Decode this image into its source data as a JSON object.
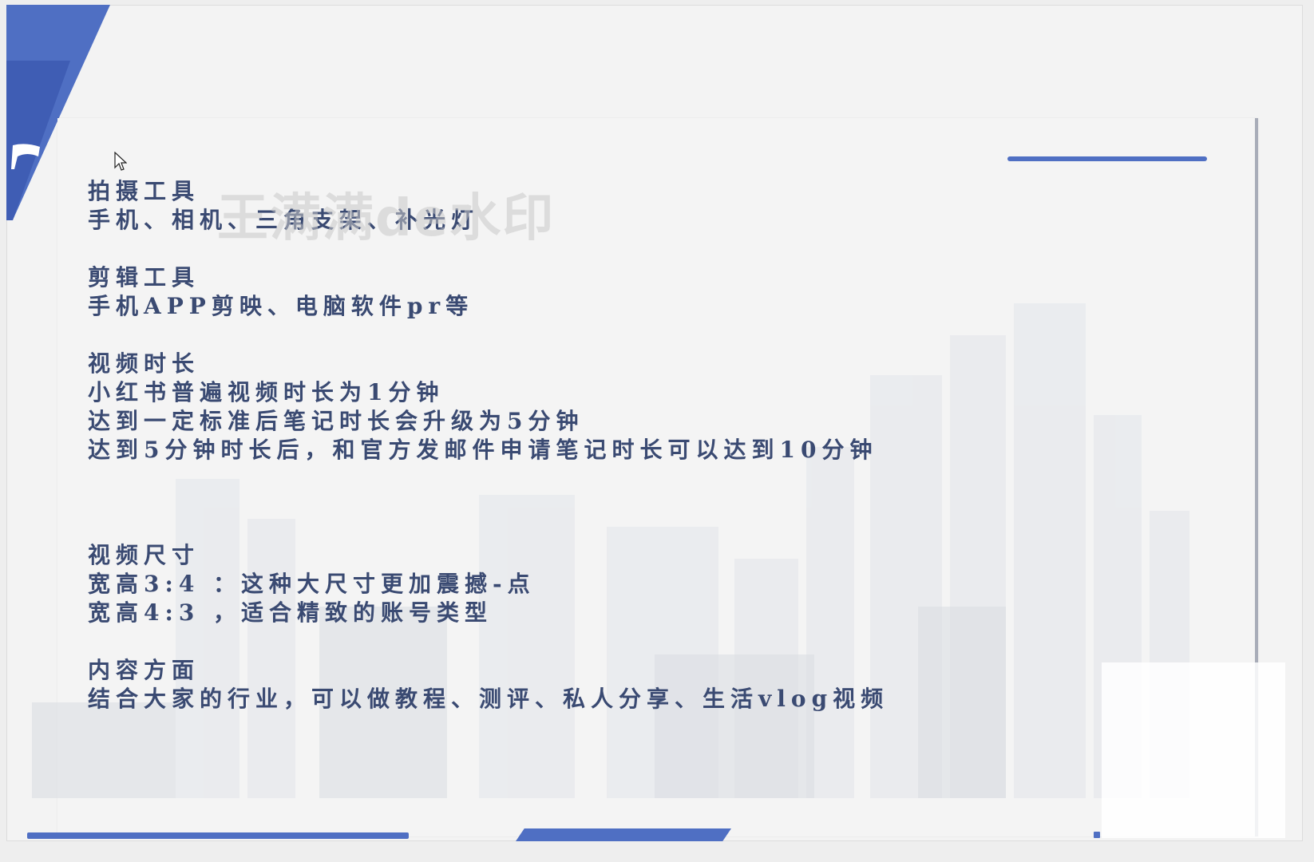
{
  "watermark": "王满满de水印",
  "sections": [
    {
      "heading": "拍摄工具",
      "lines": [
        "手机、相机、三角支架、补光灯"
      ]
    },
    {
      "heading": "剪辑工具",
      "lines": [
        "手机APP剪映、电脑软件pr等"
      ]
    },
    {
      "heading": "视频时长",
      "lines": [
        "小红书普遍视频时长为1分钟",
        "达到一定标准后笔记时长会升级为5分钟",
        "达到5分钟时长后，和官方发邮件申请笔记时长可以达到10分钟"
      ]
    },
    {
      "heading": "视频尺寸",
      "lines": [
        "宽高3:4 ：这种大尺寸更加震撼-点",
        "宽高4:3 ，适合精致的账号类型"
      ]
    },
    {
      "heading": "内容方面",
      "lines": [
        "结合大家的行业，可以做教程、测评、私人分享、生活vlog视频"
      ]
    }
  ],
  "colors": {
    "accent": "#4f6fc3",
    "text": "#3a4a72",
    "background": "#f4f4f4"
  },
  "icons": {
    "cursor": "mouse-pointer-icon",
    "corner_logo": "flag-logo-icon"
  }
}
